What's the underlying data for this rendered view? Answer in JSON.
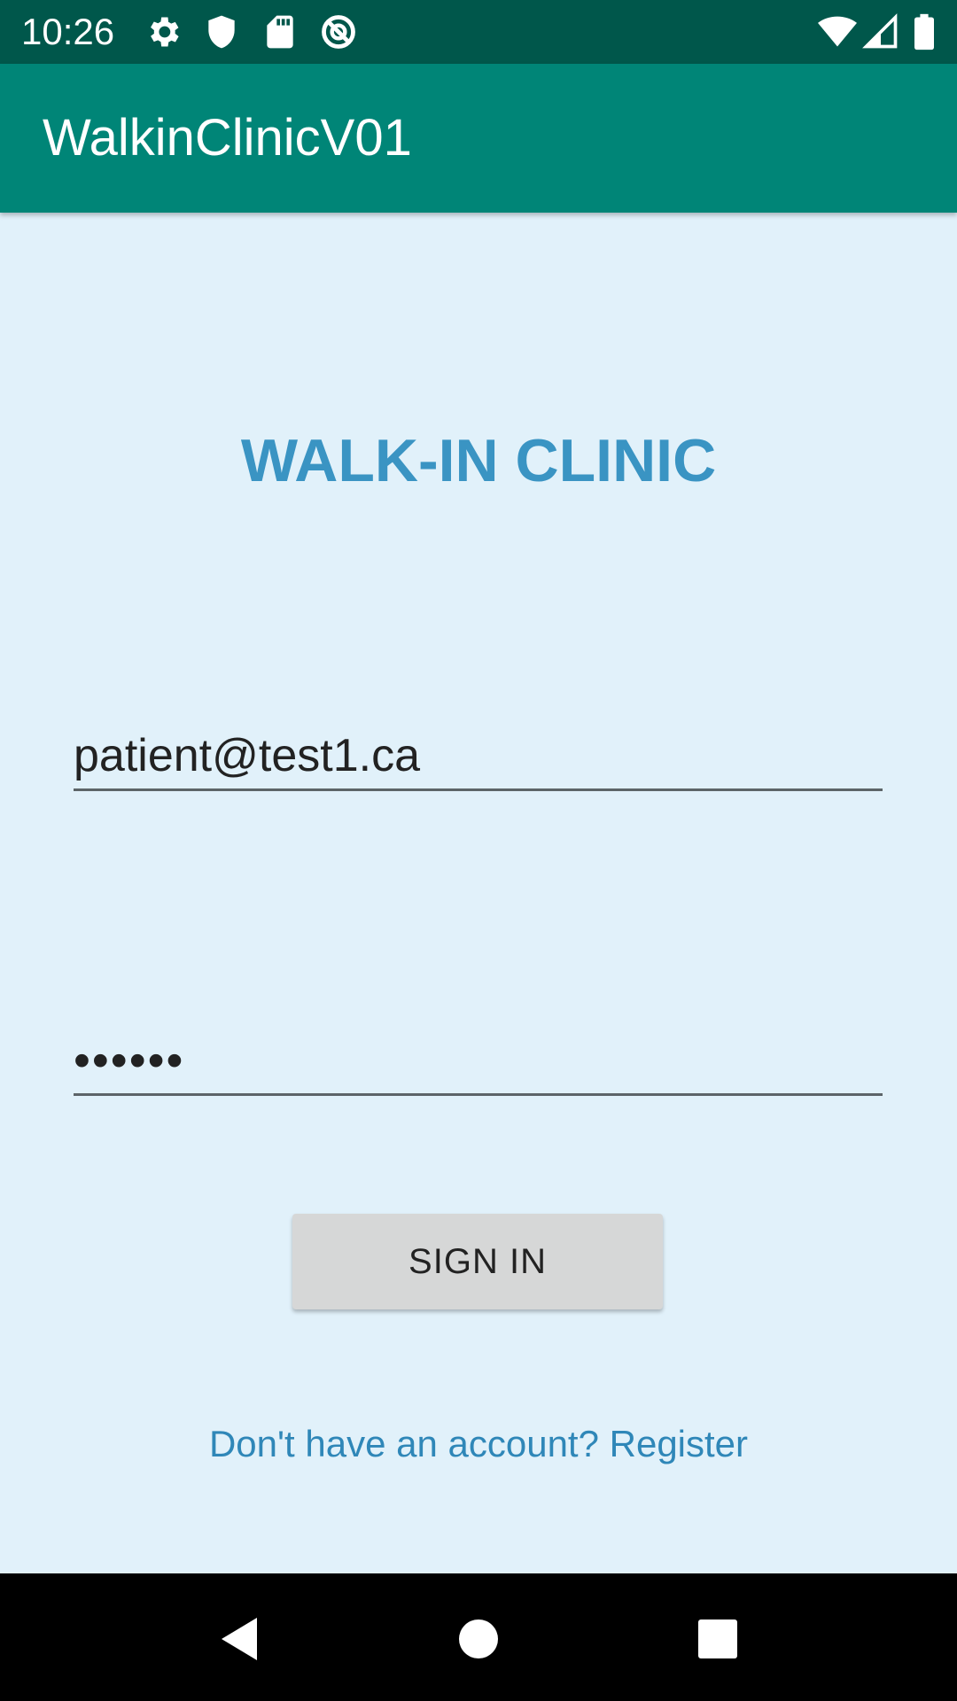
{
  "status_bar": {
    "time": "10:26",
    "left_icons": [
      "gear-icon",
      "shield-icon",
      "sd-card-icon",
      "no-data-icon"
    ],
    "right_icons": [
      "wifi-icon",
      "cell-signal-icon",
      "battery-icon"
    ]
  },
  "app_bar": {
    "title": "WalkinClinicV01",
    "color": "#008577"
  },
  "main": {
    "heading": "WALK-IN CLINIC",
    "heading_color": "#3A94C3",
    "email_value": "patient@test1.ca",
    "password_value": "••••••",
    "sign_in_label": "SIGN IN",
    "register_link": "Don't have an account? Register",
    "background": "#E1F1FA"
  },
  "nav_bar": {
    "buttons": [
      "back-icon",
      "home-icon",
      "recents-icon"
    ]
  }
}
